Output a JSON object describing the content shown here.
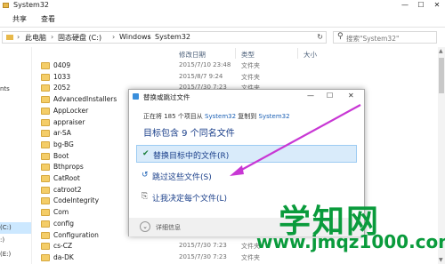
{
  "window": {
    "title": "System32",
    "minimize": "—",
    "maximize": "☐",
    "close": "✕"
  },
  "ribbon": {
    "tabs": [
      "共享",
      "查看"
    ]
  },
  "address": {
    "crumbs": [
      "此电脑",
      "固态硬盘 (C:)",
      "Windows",
      "System32"
    ],
    "separator": "›",
    "refresh": "↻",
    "search_placeholder": "搜索\"System32\"",
    "search_icon": "search-icon"
  },
  "nav": {
    "items": [
      "",
      "nts",
      "",
      "",
      "",
      "",
      "",
      "",
      "",
      "",
      "",
      "",
      "",
      "",
      "",
      "(C:)",
      ":)",
      "(E:)"
    ],
    "selected_index": 15
  },
  "columns": {
    "date": "修改日期",
    "type": "类型",
    "size": "大小"
  },
  "files": [
    {
      "name": "0409",
      "date": "2015/7/10 23:48",
      "type": "文件夹"
    },
    {
      "name": "1033",
      "date": "2015/8/7 9:24",
      "type": "文件夹"
    },
    {
      "name": "2052",
      "date": "2015/7/30 7:23",
      "type": "文件夹"
    },
    {
      "name": "AdvancedInstallers",
      "date": "",
      "type": ""
    },
    {
      "name": "AppLocker",
      "date": "",
      "type": ""
    },
    {
      "name": "appraiser",
      "date": "",
      "type": ""
    },
    {
      "name": "ar-SA",
      "date": "",
      "type": ""
    },
    {
      "name": "bg-BG",
      "date": "",
      "type": ""
    },
    {
      "name": "Boot",
      "date": "",
      "type": ""
    },
    {
      "name": "Bthprops",
      "date": "",
      "type": ""
    },
    {
      "name": "CatRoot",
      "date": "",
      "type": ""
    },
    {
      "name": "catroot2",
      "date": "",
      "type": ""
    },
    {
      "name": "CodeIntegrity",
      "date": "",
      "type": ""
    },
    {
      "name": "Com",
      "date": "",
      "type": ""
    },
    {
      "name": "config",
      "date": "",
      "type": ""
    },
    {
      "name": "Configuration",
      "date": "",
      "type": ""
    },
    {
      "name": "cs-CZ",
      "date": "2015/7/30 7:23",
      "type": "文件夹"
    },
    {
      "name": "da-DK",
      "date": "2015/7/30 7:23",
      "type": "文件夹"
    }
  ],
  "dialog": {
    "title": "替换或跳过文件",
    "minimize": "—",
    "maximize": "☐",
    "close": "✕",
    "sub_prefix": "正在将 185 个项目从",
    "sub_src": "System32",
    "sub_mid": "复制到",
    "sub_dst": "System32",
    "heading": "目标包含 9 个同名文件",
    "options": [
      {
        "icon": "✔",
        "label": "替换目标中的文件(R)",
        "selected": true
      },
      {
        "icon": "↺",
        "label": "跳过这些文件(S)",
        "selected": false
      },
      {
        "icon": "⎘",
        "label": "让我决定每个文件(L)",
        "selected": false
      }
    ],
    "more_icon": "⌄",
    "more_label": "详细信息"
  },
  "watermark": {
    "line1": "学知网",
    "line2": "www.jmqz1000.com"
  },
  "colors": {
    "accent": "#1a3f8a",
    "arrow": "#c837d4",
    "watermark": "#0a9b3c",
    "selection": "#cce8ff"
  }
}
